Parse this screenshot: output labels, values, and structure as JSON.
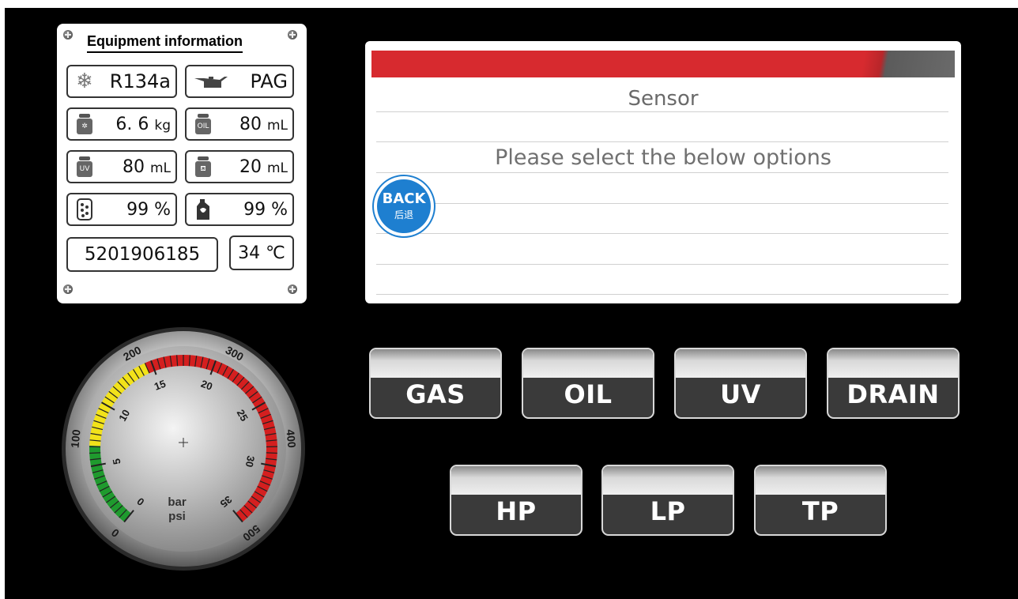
{
  "equipment": {
    "title": "Equipment information",
    "refrigerant": "R134a",
    "oil_type": "PAG",
    "gas_weight": "6. 6",
    "gas_weight_unit": "kg",
    "oil_volume": "80",
    "oil_volume_unit": "mL",
    "uv_volume": "80",
    "uv_volume_unit": "mL",
    "drain_volume": "20",
    "drain_volume_unit": "mL",
    "filter_level": "99 %",
    "oil_level": "99 %",
    "serial_number": "5201906185",
    "temperature": "34 ℃",
    "icons": [
      "snowflake-icon",
      "oil-can-icon",
      "scale-icon",
      "oil-jar-icon",
      "uv-jar-icon",
      "drain-jar-icon",
      "filter-icon",
      "oil-bottle-icon"
    ]
  },
  "panel": {
    "title": "Sensor",
    "subtitle": "Please select the below options",
    "back_label": "BACK",
    "back_sub": "后退",
    "bar_color": "#d72a2f"
  },
  "buttons": {
    "gas": "GAS",
    "oil": "OIL",
    "uv": "UV",
    "drain": "DRAIN",
    "hp": "HP",
    "lp": "LP",
    "tp": "TP"
  },
  "gauge": {
    "unit_primary": "bar",
    "unit_secondary": "psi",
    "bar_labels": [
      "0",
      "5",
      "10",
      "15",
      "20",
      "25",
      "30",
      "35"
    ],
    "psi_labels": [
      "0",
      "100",
      "200",
      "300",
      "400",
      "500"
    ],
    "colors": {
      "green": "#1f9a2e",
      "yellow": "#f2e21a",
      "red": "#d41f1f"
    }
  }
}
